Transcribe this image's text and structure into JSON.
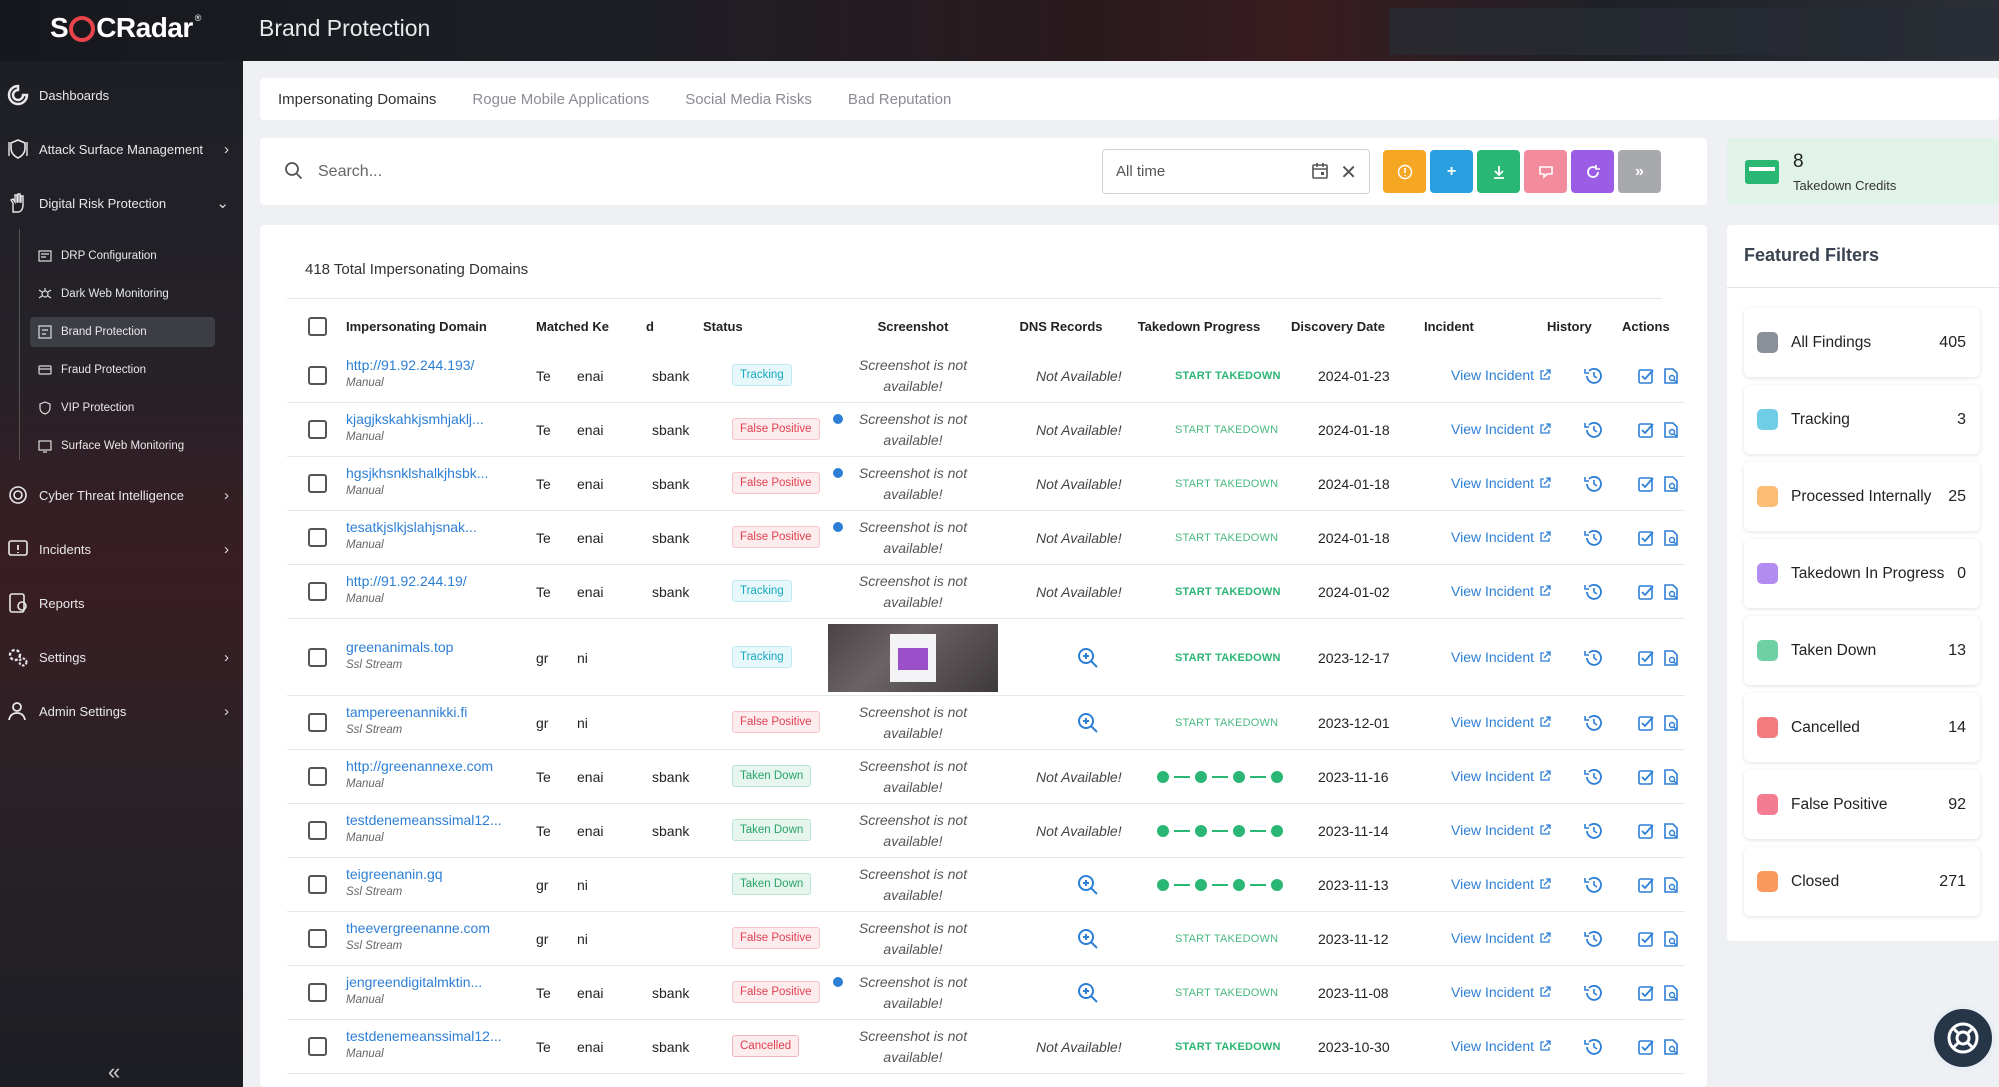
{
  "app": {
    "logo_text": "SOCRadar",
    "page_title": "Brand Protection"
  },
  "sidebar": {
    "items": [
      {
        "label": "Dashboards",
        "icon": "dashboard-icon"
      },
      {
        "label": "Attack Surface Management",
        "icon": "shield-icon"
      },
      {
        "label": "Digital Risk Protection",
        "icon": "hand-icon"
      },
      {
        "label": "Cyber Threat Intelligence",
        "icon": "radar-icon"
      },
      {
        "label": "Incidents",
        "icon": "alert-icon"
      },
      {
        "label": "Reports",
        "icon": "report-icon"
      },
      {
        "label": "Settings",
        "icon": "gear-icon"
      },
      {
        "label": "Admin Settings",
        "icon": "admin-icon"
      }
    ],
    "sub_items": [
      {
        "label": "DRP Configuration"
      },
      {
        "label": "Dark Web Monitoring"
      },
      {
        "label": "Brand Protection"
      },
      {
        "label": "Fraud Protection"
      },
      {
        "label": "VIP Protection"
      },
      {
        "label": "Surface Web Monitoring"
      }
    ],
    "collapse_glyph": "«"
  },
  "tabs": [
    {
      "label": "Impersonating Domains"
    },
    {
      "label": "Rogue Mobile Applications"
    },
    {
      "label": "Social Media Risks"
    },
    {
      "label": "Bad Reputation"
    }
  ],
  "search": {
    "placeholder": "Search...",
    "date_filter": "All time"
  },
  "toolbar": {
    "colors": {
      "info": "#f5a623",
      "add": "#2a9fe0",
      "download": "#2ab673",
      "dislike": "#f28b9b",
      "refresh": "#9b5de5",
      "more": "#a7a9ad"
    },
    "more_label": "»"
  },
  "credits": {
    "count": "8",
    "label": "Takedown Credits"
  },
  "table": {
    "total_label": "418 Total Impersonating Domains",
    "headers": {
      "domain": "Impersonating Domain",
      "matched": "Matched Ke",
      "cut": "d",
      "status": "Status",
      "screenshot": "Screenshot",
      "dns": "DNS Records",
      "progress": "Takedown Progress",
      "date": "Discovery Date",
      "incident": "Incident",
      "history": "History",
      "actions": "Actions"
    },
    "rows": [
      {
        "domain": "http://91.92.244.193/",
        "source": "Manual",
        "mk": "Te",
        "mk2": "enai",
        "col3": "sbank",
        "status": "Tracking",
        "status_kind": "tracking",
        "info": false,
        "shot": "Screenshot is not available!",
        "dns": "Not Available!",
        "progress": "START TAKEDOWN",
        "progress_kind": "start",
        "date": "2024-01-23",
        "incident": "View Incident"
      },
      {
        "domain": "kjagjkskahkjsmhjaklj...",
        "source": "Manual",
        "mk": "Te",
        "mk2": "enai",
        "col3": "sbank",
        "status": "False Positive",
        "status_kind": "false",
        "info": true,
        "shot": "Screenshot is not available!",
        "dns": "Not Available!",
        "progress": "START TAKEDOWN",
        "progress_kind": "dim",
        "date": "2024-01-18",
        "incident": "View Incident"
      },
      {
        "domain": "hgsjkhsnklshalkjhsbk...",
        "source": "Manual",
        "mk": "Te",
        "mk2": "enai",
        "col3": "sbank",
        "status": "False Positive",
        "status_kind": "false",
        "info": true,
        "shot": "Screenshot is not available!",
        "dns": "Not Available!",
        "progress": "START TAKEDOWN",
        "progress_kind": "dim",
        "date": "2024-01-18",
        "incident": "View Incident"
      },
      {
        "domain": "tesatkjslkjslahjsnak...",
        "source": "Manual",
        "mk": "Te",
        "mk2": "enai",
        "col3": "sbank",
        "status": "False Positive",
        "status_kind": "false",
        "info": true,
        "shot": "Screenshot is not available!",
        "dns": "Not Available!",
        "progress": "START TAKEDOWN",
        "progress_kind": "dim",
        "date": "2024-01-18",
        "incident": "View Incident"
      },
      {
        "domain": "http://91.92.244.19/",
        "source": "Manual",
        "mk": "Te",
        "mk2": "enai",
        "col3": "sbank",
        "status": "Tracking",
        "status_kind": "tracking",
        "info": false,
        "shot": "Screenshot is not available!",
        "dns": "Not Available!",
        "progress": "START TAKEDOWN",
        "progress_kind": "start",
        "date": "2024-01-02",
        "incident": "View Incident"
      },
      {
        "domain": "greenanimals.top",
        "source": "Ssl Stream",
        "mk": "gr",
        "mk2": "ni",
        "col3": "",
        "status": "Tracking",
        "status_kind": "tracking",
        "info": false,
        "shot": "",
        "dns": "",
        "progress": "START TAKEDOWN",
        "progress_kind": "start",
        "date": "2023-12-17",
        "incident": "View Incident"
      },
      {
        "domain": "tampereenannikki.fi",
        "source": "Ssl Stream",
        "mk": "gr",
        "mk2": "ni",
        "col3": "",
        "status": "False Positive",
        "status_kind": "false",
        "info": false,
        "shot": "Screenshot is not available!",
        "dns": "",
        "progress": "START TAKEDOWN",
        "progress_kind": "dim",
        "date": "2023-12-01",
        "incident": "View Incident"
      },
      {
        "domain": "http://greenannexe.com",
        "source": "Manual",
        "mk": "Te",
        "mk2": "enai",
        "col3": "sbank",
        "status": "Taken Down",
        "status_kind": "down",
        "info": false,
        "shot": "Screenshot is not available!",
        "dns": "Not Available!",
        "progress": "",
        "progress_kind": "dots",
        "date": "2023-11-16",
        "incident": "View Incident"
      },
      {
        "domain": "testdenemeanssimal12...",
        "source": "Manual",
        "mk": "Te",
        "mk2": "enai",
        "col3": "sbank",
        "status": "Taken Down",
        "status_kind": "down",
        "info": false,
        "shot": "Screenshot is not available!",
        "dns": "Not Available!",
        "progress": "",
        "progress_kind": "dots",
        "date": "2023-11-14",
        "incident": "View Incident"
      },
      {
        "domain": "teigreenanin.gq",
        "source": "Ssl Stream",
        "mk": "gr",
        "mk2": "ni",
        "col3": "",
        "status": "Taken Down",
        "status_kind": "down",
        "info": false,
        "shot": "Screenshot is not available!",
        "dns": "",
        "progress": "",
        "progress_kind": "dots",
        "date": "2023-11-13",
        "incident": "View Incident"
      },
      {
        "domain": "theevergreenanne.com",
        "source": "Ssl Stream",
        "mk": "gr",
        "mk2": "ni",
        "col3": "",
        "status": "False Positive",
        "status_kind": "false",
        "info": false,
        "shot": "Screenshot is not available!",
        "dns": "",
        "progress": "START TAKEDOWN",
        "progress_kind": "dim",
        "date": "2023-11-12",
        "incident": "View Incident"
      },
      {
        "domain": "jengreendigitalmktin...",
        "source": "Manual",
        "mk": "Te",
        "mk2": "enai",
        "col3": "sbank",
        "status": "False Positive",
        "status_kind": "false",
        "info": true,
        "shot": "Screenshot is not available!",
        "dns": "",
        "progress": "START TAKEDOWN",
        "progress_kind": "dim",
        "date": "2023-11-08",
        "incident": "View Incident"
      },
      {
        "domain": "testdenemeanssimal12...",
        "source": "Manual",
        "mk": "Te",
        "mk2": "enai",
        "col3": "sbank",
        "status": "Cancelled",
        "status_kind": "cancel",
        "info": false,
        "shot": "Screenshot is not available!",
        "dns": "Not Available!",
        "progress": "START TAKEDOWN",
        "progress_kind": "start",
        "date": "2023-10-30",
        "incident": "View Incident"
      }
    ]
  },
  "featured_filters": {
    "title": "Featured Filters",
    "items": [
      {
        "label": "All Findings",
        "count": "405",
        "color": "#8a8f99"
      },
      {
        "label": "Tracking",
        "count": "3",
        "color": "#6fcde6"
      },
      {
        "label": "Processed Internally",
        "count": "25",
        "color": "#fbbd74"
      },
      {
        "label": "Takedown In Progress",
        "count": "0",
        "color": "#b28cf0"
      },
      {
        "label": "Taken Down",
        "count": "13",
        "color": "#6fd0a6"
      },
      {
        "label": "Cancelled",
        "count": "14",
        "color": "#f37b80"
      },
      {
        "label": "False Positive",
        "count": "92",
        "color": "#f37b92"
      },
      {
        "label": "Closed",
        "count": "271",
        "color": "#fb9a5e"
      }
    ]
  }
}
